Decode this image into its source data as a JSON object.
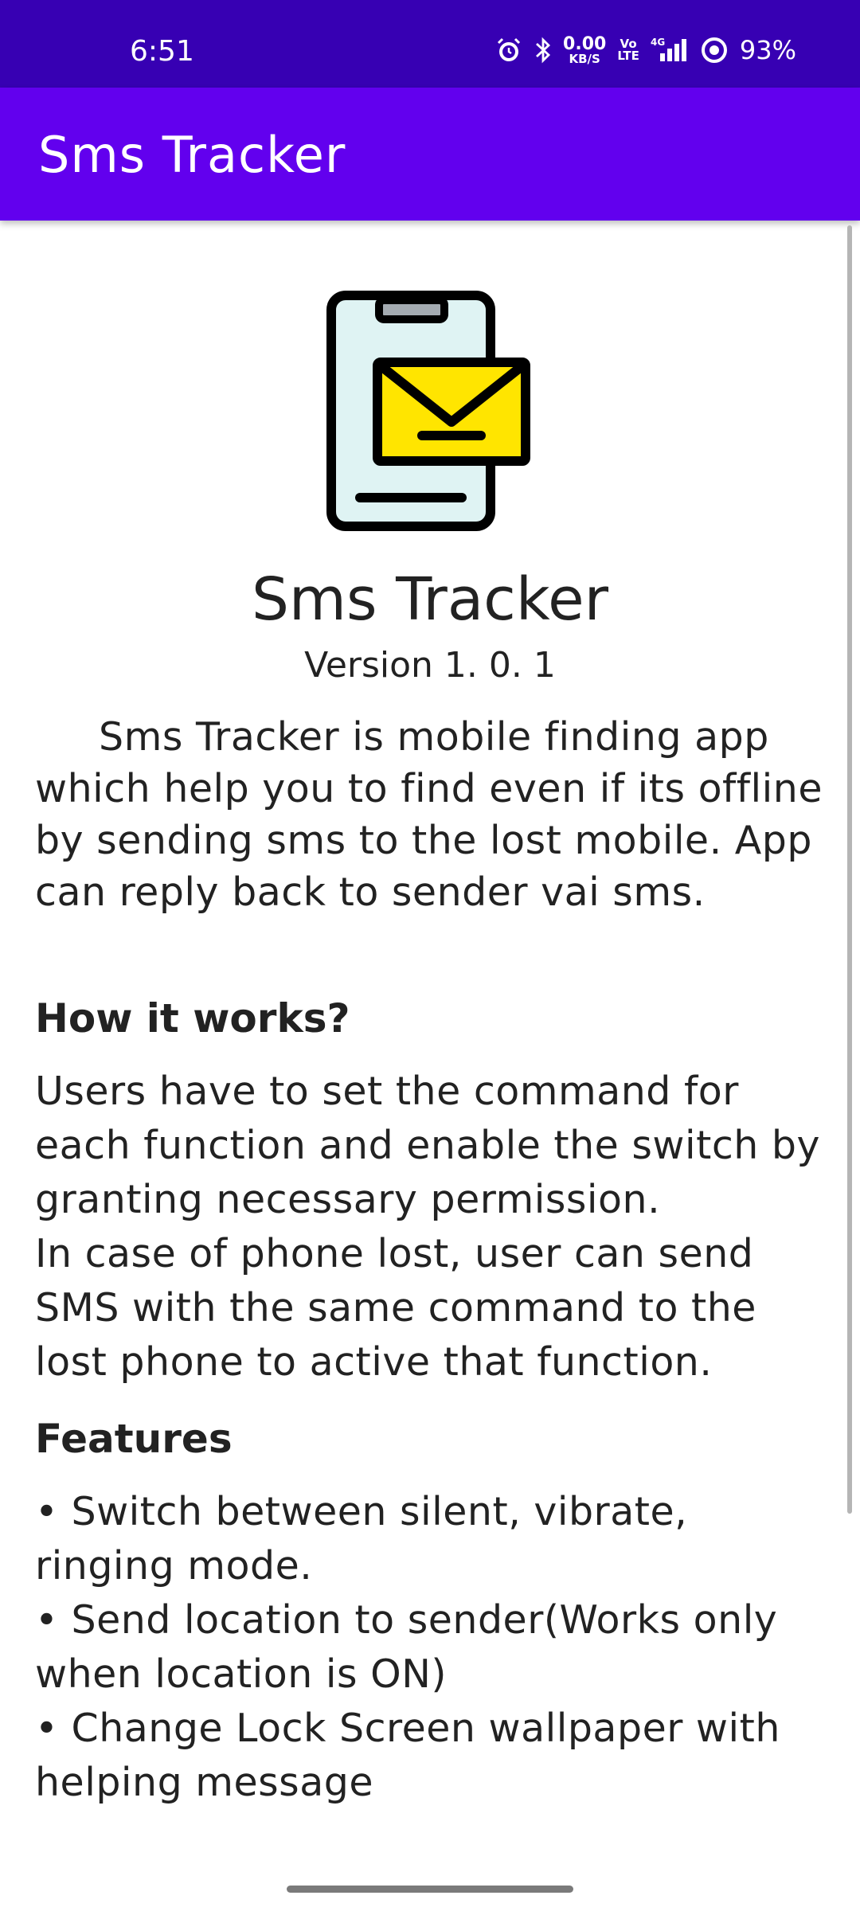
{
  "status_bar": {
    "time": "6:51",
    "net_speed_value": "0.00",
    "net_speed_unit": "KB/S",
    "volte_top": "Vo",
    "volte_bottom": "LTE",
    "network": "4G",
    "battery": "93%",
    "icons": [
      "alarm-icon",
      "bluetooth-icon",
      "signal-icon",
      "data-saver-icon"
    ]
  },
  "app_bar": {
    "title": "Sms Tracker"
  },
  "about": {
    "title": "Sms Tracker",
    "version": "Version 1. 0. 1",
    "description": "Sms Tracker is mobile finding app which help you to find even if its offline by sending sms to the lost mobile. App can reply back to sender vai sms.",
    "how_heading": "How it works?",
    "how_lines": [
      "Users have to set the command for each function and enable the switch by granting necessary permission.",
      "In case of phone lost, user can send SMS with the same command to the lost phone to active that function."
    ],
    "features_heading": "Features",
    "features": [
      "• Switch between silent, vibrate, ringing mode.",
      "• Send location to sender(Works only when location is ON)",
      "• Change Lock Screen wallpaper with helping message"
    ]
  },
  "colors": {
    "status_bar": "#3700b3",
    "app_bar": "#6200ee",
    "envelope": "#ffe500",
    "phone_screen": "#dff3f3"
  }
}
